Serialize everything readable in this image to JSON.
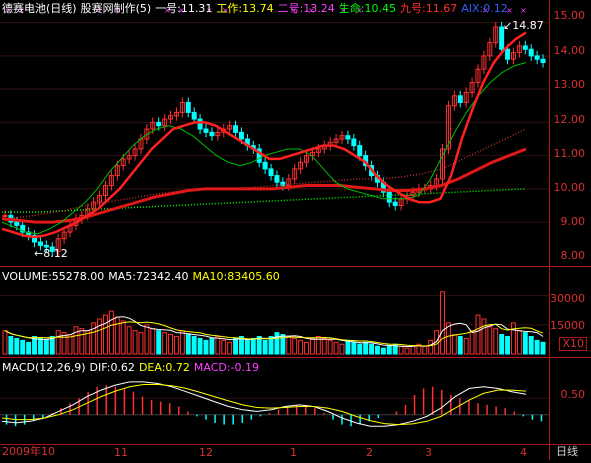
{
  "header": {
    "title": "德赛电池(日线)",
    "brand": "股赛网制作(5)",
    "lines": [
      {
        "label": "一号:11.31",
        "color": "#ffffff"
      },
      {
        "label": "工作:13.74",
        "color": "#ffff00"
      },
      {
        "label": "二号:13.24",
        "color": "#ff40ff"
      },
      {
        "label": "生命:10.45",
        "color": "#00ff00"
      },
      {
        "label": "九号:11.67",
        "color": "#ff3030"
      }
    ],
    "aix": "AIX:0.12"
  },
  "volume_header": {
    "volume": "VOLUME:55278.00",
    "ma5": "MA5:72342.40",
    "ma10": "MA10:83405.60"
  },
  "macd_header": {
    "params": "MACD(12,26,9)",
    "dif": "DIF:0.62",
    "dea": "DEA:0.72",
    "macd": "MACD:-0.19"
  },
  "price_axis": [
    "15.00",
    "14.00",
    "13.00",
    "12.00",
    "11.00",
    "10.00",
    "9.00",
    "8.00"
  ],
  "volume_axis": [
    "30000",
    "15000"
  ],
  "volume_unit": "X10",
  "macd_axis": [
    "0.50"
  ],
  "x_labels": [
    "2009年10",
    "11",
    "12",
    "1",
    "2",
    "3",
    "4"
  ],
  "annotations": {
    "high": "14.87",
    "low": "8.12"
  },
  "indicator_label": "日线",
  "chart_data": {
    "type": "line",
    "title": "德赛电池(日线)",
    "price_range": [
      7.8,
      15.2
    ],
    "volume_range": [
      0,
      36000
    ],
    "macd_range": [
      -0.8,
      1.3
    ],
    "close": [
      9.2,
      9.0,
      8.9,
      8.7,
      8.6,
      8.4,
      8.3,
      8.25,
      8.12,
      8.5,
      8.7,
      8.9,
      9.1,
      9.2,
      9.4,
      9.6,
      9.8,
      10.1,
      10.4,
      10.7,
      10.9,
      11.0,
      11.2,
      11.5,
      11.8,
      12.0,
      11.9,
      12.1,
      12.2,
      12.3,
      12.6,
      12.3,
      12.1,
      11.8,
      11.7,
      11.6,
      11.7,
      11.8,
      11.9,
      11.7,
      11.5,
      11.3,
      11.2,
      10.8,
      10.6,
      10.4,
      10.2,
      10.1,
      10.3,
      10.6,
      10.8,
      11.0,
      11.1,
      11.2,
      11.3,
      11.4,
      11.5,
      11.6,
      11.5,
      11.3,
      11.0,
      10.7,
      10.4,
      10.2,
      9.9,
      9.6,
      9.5,
      9.7,
      9.8,
      9.9,
      10.0,
      10.0,
      10.1,
      10.3,
      11.2,
      12.5,
      12.8,
      12.6,
      12.9,
      13.2,
      13.6,
      14.0,
      14.4,
      14.87,
      14.2,
      13.9,
      14.1,
      14.3,
      14.2,
      14.0,
      13.9,
      13.8
    ],
    "line_red": [
      8.8,
      8.7,
      8.6,
      8.55,
      8.6,
      8.7,
      8.85,
      9.0,
      9.2,
      9.4,
      9.7,
      10.0,
      10.4,
      10.8,
      11.2,
      11.5,
      11.8,
      11.9,
      12.0,
      12.0,
      11.9,
      11.7,
      11.5,
      11.3,
      11.1,
      10.9,
      10.9,
      11.0,
      11.1,
      11.2,
      11.3,
      11.3,
      11.2,
      11.0,
      10.8,
      10.4,
      10.1,
      9.9,
      9.7,
      9.6,
      9.6,
      9.7,
      10.4,
      11.5,
      12.4,
      13.2,
      13.8,
      14.2,
      14.5,
      14.7
    ],
    "line_green": [
      9.0,
      8.85,
      8.7,
      8.65,
      8.8,
      9.0,
      9.3,
      9.6,
      10.0,
      10.5,
      10.9,
      11.3,
      11.6,
      11.8,
      11.9,
      11.8,
      11.6,
      11.3,
      11.0,
      10.8,
      10.7,
      10.8,
      11.0,
      11.1,
      11.2,
      11.2,
      11.0,
      10.6,
      10.2,
      10.0,
      9.9,
      9.8,
      9.7,
      9.7,
      9.7,
      9.8,
      10.3,
      11.0,
      11.7,
      12.3,
      12.8,
      13.2,
      13.5,
      13.7,
      13.8
    ],
    "line_darkred": [
      9.1,
      9.05,
      9.0,
      9.0,
      9.05,
      9.15,
      9.3,
      9.45,
      9.6,
      9.75,
      9.85,
      9.95,
      10.0,
      10.0,
      10.0,
      10.0,
      10.0,
      10.05,
      10.1,
      10.1,
      10.1,
      10.05,
      10.0,
      9.95,
      9.95,
      10.0,
      10.1,
      10.3,
      10.55,
      10.8,
      11.0,
      11.2
    ],
    "line_dotted_a": [
      9.1,
      9.15,
      9.25,
      9.35,
      9.5,
      9.6,
      9.7,
      9.8,
      9.9,
      9.95,
      10.0,
      10.0,
      10.05,
      10.1,
      10.15,
      10.2,
      10.25,
      10.3,
      10.3,
      10.35,
      10.45,
      10.6,
      10.9,
      11.2,
      11.5,
      11.8
    ],
    "line_dotted_b": [
      9.3,
      9.3,
      9.35,
      9.4,
      9.45,
      9.5,
      9.55,
      9.6,
      9.65,
      9.7,
      9.75,
      9.8,
      9.85,
      9.9,
      9.95,
      10.0
    ],
    "volume": [
      12000,
      9000,
      8000,
      7000,
      6000,
      9000,
      8000,
      7500,
      9000,
      12000,
      11000,
      10000,
      14000,
      13000,
      12000,
      16000,
      18000,
      20000,
      22000,
      19000,
      17000,
      14000,
      12000,
      11000,
      15000,
      13000,
      12000,
      11000,
      10000,
      9000,
      12000,
      10000,
      9000,
      8000,
      7000,
      8000,
      9000,
      7000,
      6000,
      8000,
      9000,
      7000,
      8000,
      9000,
      7000,
      9000,
      11000,
      10000,
      9000,
      8000,
      7000,
      6000,
      8000,
      9000,
      8000,
      7000,
      6000,
      5000,
      7000,
      6000,
      5000,
      6000,
      5000,
      4000,
      3000,
      4000,
      5000,
      4000,
      3000,
      4000,
      5000,
      4000,
      7000,
      12000,
      32000,
      16000,
      10000,
      9000,
      8000,
      12000,
      20000,
      18000,
      14000,
      13000,
      10000,
      9000,
      16000,
      12000,
      11000,
      9000,
      7000,
      6000
    ],
    "macd_hist": [
      -0.3,
      -0.35,
      -0.3,
      -0.2,
      -0.1,
      0.05,
      0.2,
      0.35,
      0.5,
      0.7,
      0.85,
      0.9,
      0.85,
      0.8,
      0.7,
      0.55,
      0.45,
      0.4,
      0.35,
      0.25,
      0.1,
      -0.05,
      -0.15,
      -0.25,
      -0.3,
      -0.3,
      -0.25,
      -0.15,
      -0.05,
      0.05,
      0.15,
      0.25,
      0.3,
      0.3,
      0.2,
      0.05,
      -0.15,
      -0.3,
      -0.35,
      -0.3,
      -0.2,
      -0.1,
      0.0,
      0.1,
      0.3,
      0.6,
      0.8,
      0.85,
      0.75,
      0.6,
      0.5,
      0.45,
      0.35,
      0.3,
      0.25,
      0.2,
      0.1,
      -0.05,
      -0.15,
      -0.2
    ],
    "macd_dif": [
      -0.2,
      -0.25,
      -0.2,
      -0.1,
      0.1,
      0.3,
      0.55,
      0.75,
      0.9,
      1.0,
      1.0,
      0.95,
      0.85,
      0.7,
      0.55,
      0.4,
      0.25,
      0.15,
      0.1,
      0.15,
      0.25,
      0.3,
      0.25,
      0.1,
      -0.1,
      -0.25,
      -0.35,
      -0.35,
      -0.3,
      -0.2,
      -0.05,
      0.2,
      0.55,
      0.8,
      0.85,
      0.8,
      0.7,
      0.62
    ],
    "macd_dea": [
      -0.1,
      -0.15,
      -0.15,
      -0.1,
      0.0,
      0.15,
      0.35,
      0.55,
      0.72,
      0.85,
      0.92,
      0.92,
      0.88,
      0.8,
      0.68,
      0.55,
      0.42,
      0.3,
      0.22,
      0.2,
      0.22,
      0.25,
      0.25,
      0.2,
      0.1,
      -0.05,
      -0.18,
      -0.27,
      -0.3,
      -0.28,
      -0.2,
      -0.05,
      0.2,
      0.45,
      0.65,
      0.75,
      0.75,
      0.72
    ]
  }
}
